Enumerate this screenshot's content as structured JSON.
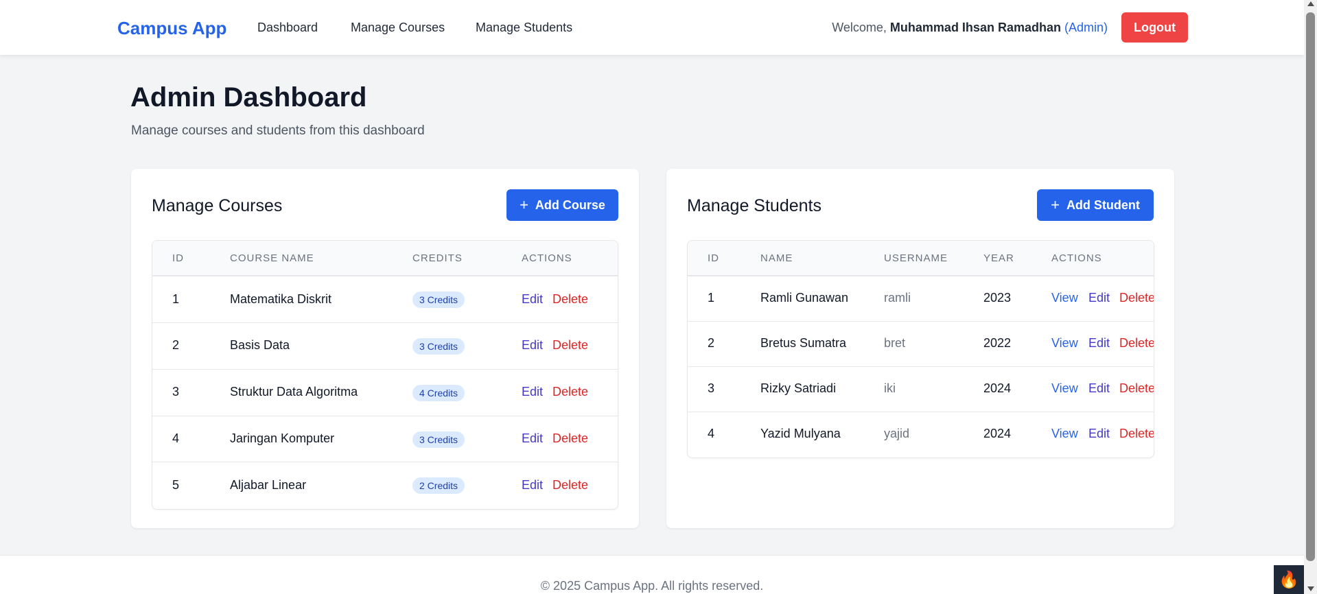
{
  "navbar": {
    "brand": "Campus App",
    "links": [
      "Dashboard",
      "Manage Courses",
      "Manage Students"
    ],
    "welcome_prefix": "Welcome, ",
    "user_name": "Muhammad Ihsan Ramadhan",
    "role_open": " (",
    "role": "Admin",
    "role_close": ")",
    "logout": "Logout"
  },
  "header": {
    "title": "Admin Dashboard",
    "subtitle": "Manage courses and students from this dashboard"
  },
  "courses": {
    "title": "Manage Courses",
    "add_button": "Add Course",
    "columns": [
      "ID",
      "COURSE NAME",
      "CREDITS",
      "ACTIONS"
    ],
    "rows": [
      {
        "id": "1",
        "name": "Matematika Diskrit",
        "credits": "3 Credits"
      },
      {
        "id": "2",
        "name": "Basis Data",
        "credits": "3 Credits"
      },
      {
        "id": "3",
        "name": "Struktur Data Algoritma",
        "credits": "4 Credits"
      },
      {
        "id": "4",
        "name": "Jaringan Komputer",
        "credits": "3 Credits"
      },
      {
        "id": "5",
        "name": "Aljabar Linear",
        "credits": "2 Credits"
      }
    ],
    "edit_label": "Edit",
    "delete_label": "Delete"
  },
  "students": {
    "title": "Manage Students",
    "add_button": "Add Student",
    "columns": [
      "ID",
      "NAME",
      "USERNAME",
      "YEAR",
      "ACTIONS"
    ],
    "rows": [
      {
        "id": "1",
        "name": "Ramli Gunawan",
        "username": "ramli",
        "year": "2023"
      },
      {
        "id": "2",
        "name": "Bretus Sumatra",
        "username": "bret",
        "year": "2022"
      },
      {
        "id": "3",
        "name": "Rizky Satriadi",
        "username": "iki",
        "year": "2024"
      },
      {
        "id": "4",
        "name": "Yazid Mulyana",
        "username": "yajid",
        "year": "2024"
      }
    ],
    "view_label": "View",
    "edit_label": "Edit",
    "delete_label": "Delete"
  },
  "footer": {
    "text": "© 2025 Campus App. All rights reserved."
  },
  "icons": {
    "plus": "plus-icon",
    "corner": "flame-icon"
  },
  "colors": {
    "brand": "#2563eb",
    "logout": "#ef4444",
    "edit": "#4338ca",
    "delete": "#dc2626"
  }
}
